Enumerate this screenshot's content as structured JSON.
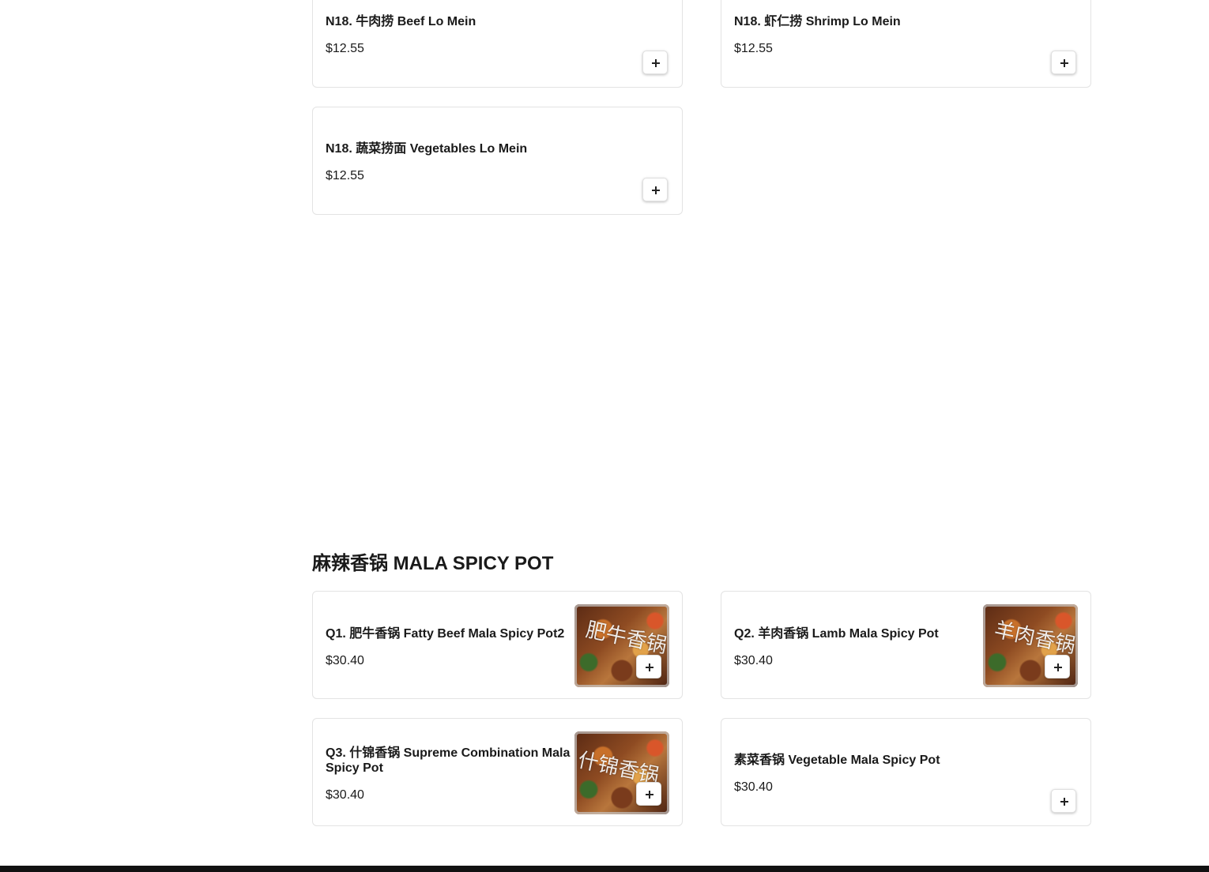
{
  "noodles_section": {
    "items": [
      {
        "name": "N18. 牛肉捞 Beef Lo Mein",
        "price": "$12.55"
      },
      {
        "name": "N18. 虾仁捞 Shrimp Lo Mein",
        "price": "$12.55"
      },
      {
        "name": "N18. 蔬菜捞面 Vegetables Lo Mein",
        "price": "$12.55"
      }
    ]
  },
  "mala_section": {
    "title": "麻辣香锅 MALA SPICY POT",
    "items": [
      {
        "name": "Q1. 肥牛香锅 Fatty Beef Mala Spicy Pot2",
        "price": "$30.40",
        "image_text": "肥牛香锅"
      },
      {
        "name": "Q2. 羊肉香锅 Lamb Mala Spicy Pot",
        "price": "$30.40",
        "image_text": "羊肉香锅"
      },
      {
        "name": "Q3. 什锦香锅 Supreme Combination Mala Spicy Pot",
        "price": "$30.40",
        "image_text": "什锦香锅"
      },
      {
        "name": "素菜香锅 Vegetable Mala Spicy Pot",
        "price": "$30.40"
      }
    ]
  },
  "icons": {
    "add": "plus-icon"
  },
  "colors": {
    "card_border": "#e3e3e3",
    "text": "#1a1a1a",
    "footer": "#111111"
  }
}
